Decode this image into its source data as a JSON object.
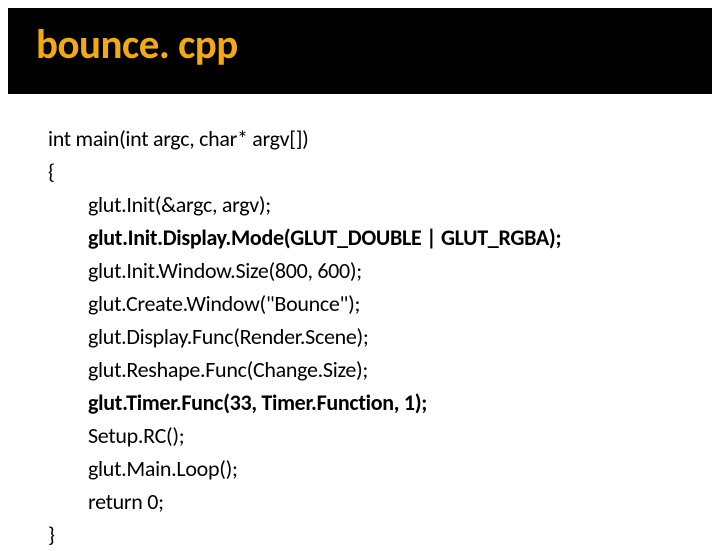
{
  "title": "bounce. cpp",
  "code": {
    "l1": "int main(int argc, char* argv[])",
    "l2": "{",
    "l3": "glut.Init(&argc, argv);",
    "l4": "glut.Init.Display.Mode(GLUT_DOUBLE | GLUT_RGBA);",
    "l5": "glut.Init.Window.Size(800, 600);",
    "l6": "glut.Create.Window(\"Bounce\");",
    "l7": "glut.Display.Func(Render.Scene);",
    "l8": "glut.Reshape.Func(Change.Size);",
    "l9": "glut.Timer.Func(33, Timer.Function, 1);",
    "l10": "Setup.RC();",
    "l11": "glut.Main.Loop();",
    "l12": "return 0;",
    "l13": "}"
  }
}
